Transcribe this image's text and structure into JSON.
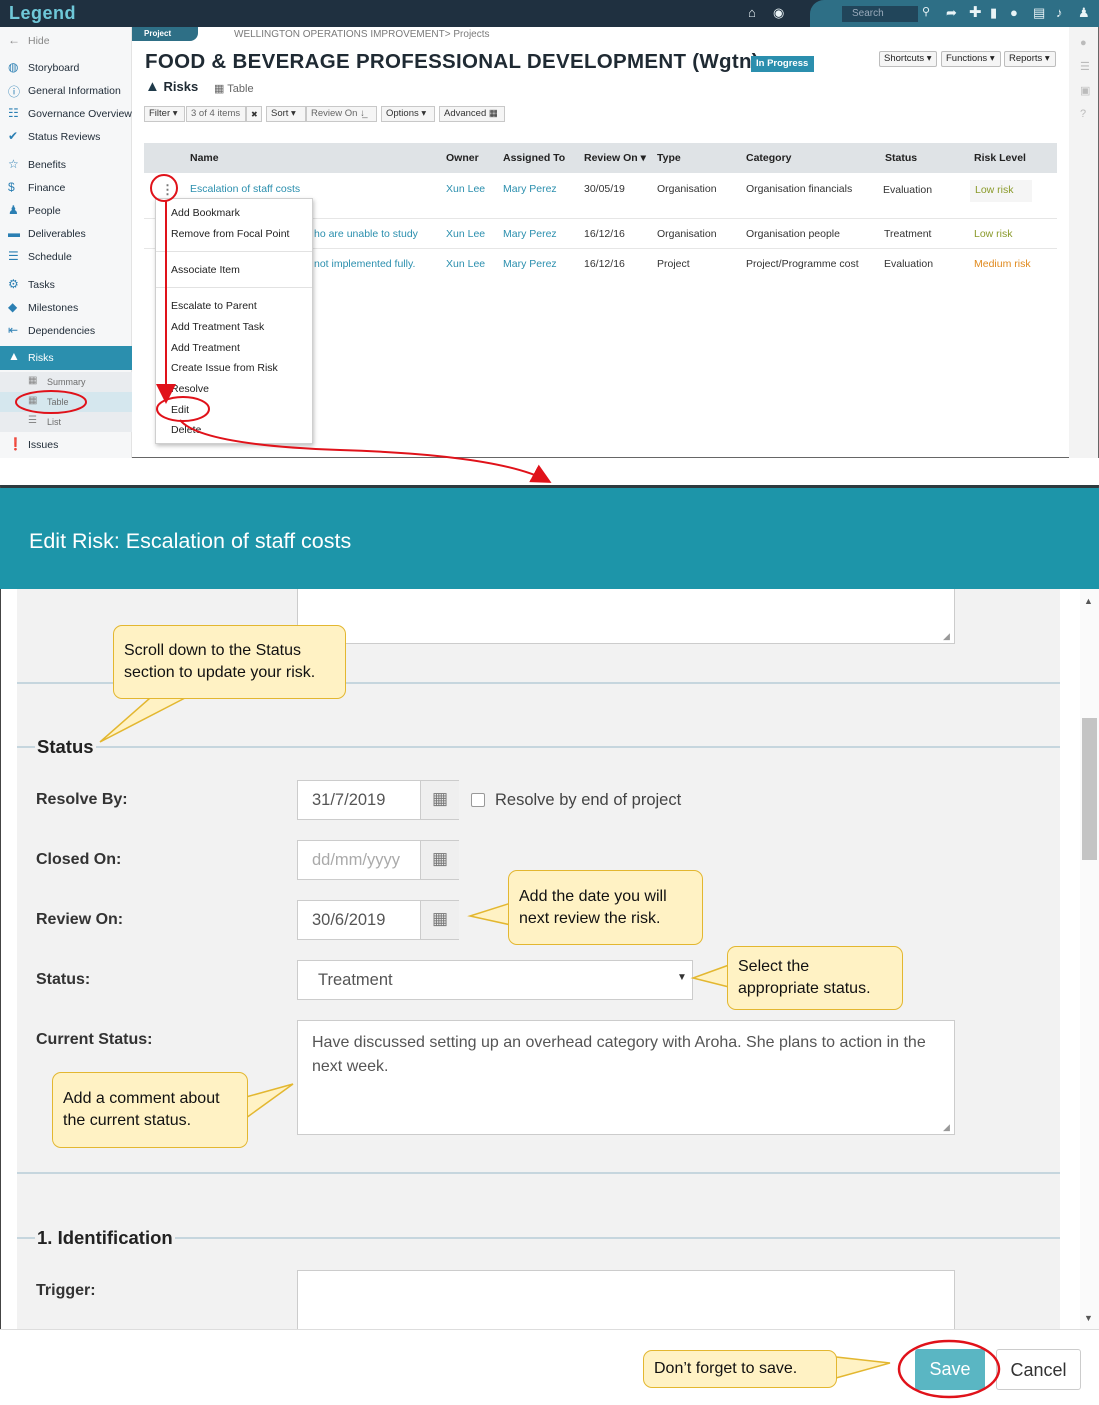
{
  "app": {
    "logo": "Legend"
  },
  "topbar": {
    "search_placeholder": "Search"
  },
  "sidebar": {
    "hide_label": "Hide",
    "items": [
      {
        "label": "Storyboard",
        "icon": "palette-icon"
      },
      {
        "label": "General Information",
        "icon": "info-icon"
      },
      {
        "label": "Governance Overview",
        "icon": "sitemap-icon"
      },
      {
        "label": "Status Reviews",
        "icon": "check-icon"
      },
      {
        "label": "Benefits",
        "icon": "star-icon"
      },
      {
        "label": "Finance",
        "icon": "dollar-icon"
      },
      {
        "label": "People",
        "icon": "people-icon"
      },
      {
        "label": "Deliverables",
        "icon": "truck-icon"
      },
      {
        "label": "Schedule",
        "icon": "schedule-icon"
      },
      {
        "label": "Tasks",
        "icon": "tasks-icon"
      },
      {
        "label": "Milestones",
        "icon": "diamond-icon"
      },
      {
        "label": "Dependencies",
        "icon": "dependencies-icon"
      },
      {
        "label": "Risks",
        "icon": "warning-icon"
      },
      {
        "label": "Issues",
        "icon": "exclamation-icon"
      }
    ],
    "risk_sub": [
      {
        "label": "Summary"
      },
      {
        "label": "Table"
      },
      {
        "label": "List"
      }
    ]
  },
  "project": {
    "tag": "Project",
    "breadcrumb": "WELLINGTON OPERATIONS IMPROVEMENT> Projects",
    "title": "FOOD & BEVERAGE PROFESSIONAL DEVELOPMENT (Wgtn)",
    "status_badge": "In Progress",
    "buttons": {
      "shortcuts": "Shortcuts ▾",
      "functions": "Functions ▾",
      "reports": "Reports ▾"
    },
    "section": "Risks",
    "view": "Table"
  },
  "filters": {
    "filter": "Filter ▾",
    "count": "3 of 4 items",
    "clear": "✖",
    "sort": "Sort ▾",
    "sort_field": "Review On ↓̲",
    "options": "Options ▾",
    "advanced": "Advanced ▦"
  },
  "table": {
    "columns": [
      "Name",
      "Owner",
      "Assigned To",
      "Review On ▾",
      "Type",
      "Category",
      "Status",
      "Risk Level"
    ],
    "rows": [
      {
        "name": "Escalation of staff costs",
        "owner": "Xun Lee",
        "assigned": "Mary Perez",
        "review": "30/05/19",
        "type": "Organisation",
        "category": "Organisation financials",
        "status": "Evaluation",
        "level": "Low risk",
        "level_color": "#8a9a2a"
      },
      {
        "name": "ho are unable to study",
        "owner": "Xun Lee",
        "assigned": "Mary Perez",
        "review": "16/12/16",
        "type": "Organisation",
        "category": "Organisation people",
        "status": "Treatment",
        "level": "Low risk",
        "level_color": "#8a9a2a"
      },
      {
        "name": "not implemented fully.",
        "owner": "Xun Lee",
        "assigned": "Mary Perez",
        "review": "16/12/16",
        "type": "Project",
        "category": "Project/Programme cost",
        "status": "Evaluation",
        "level": "Medium risk",
        "level_color": "#e08a1e"
      }
    ]
  },
  "context_menu": {
    "items": [
      "Add Bookmark",
      "Remove from Focal Point",
      "Associate Item",
      "Escalate to Parent",
      "Add Treatment Task",
      "Add Treatment",
      "Create Issue from Risk",
      "Resolve",
      "Edit",
      "Delete"
    ]
  },
  "modal": {
    "title": "Edit Risk: Escalation of staff costs",
    "status_legend": "Status",
    "fields": {
      "resolve_by_label": "Resolve By:",
      "resolve_by_value": "31/7/2019",
      "resolve_end_label": "Resolve by end of project",
      "closed_on_label": "Closed On:",
      "closed_on_placeholder": "dd/mm/yyyy",
      "review_on_label": "Review On:",
      "review_on_value": "30/6/2019",
      "status_label": "Status:",
      "status_value": "Treatment",
      "current_status_label": "Current Status:",
      "current_status_value": "Have discussed setting up an overhead category with Aroha.  She plans to action in the next week."
    },
    "identification_legend": "1. Identification",
    "trigger_label": "Trigger:",
    "save": "Save",
    "cancel": "Cancel"
  },
  "callouts": {
    "scroll": "Scroll down to the Status section to update your risk.",
    "review_date": "Add the date you will next review the risk.",
    "select_status": "Select the appropriate status.",
    "comment": "Add a comment about the current status.",
    "save": "Don’t forget to save."
  },
  "colors": {
    "accent": "#1d95a9",
    "annotation": "#e0121a",
    "callout_fill": "#fff2c4"
  }
}
